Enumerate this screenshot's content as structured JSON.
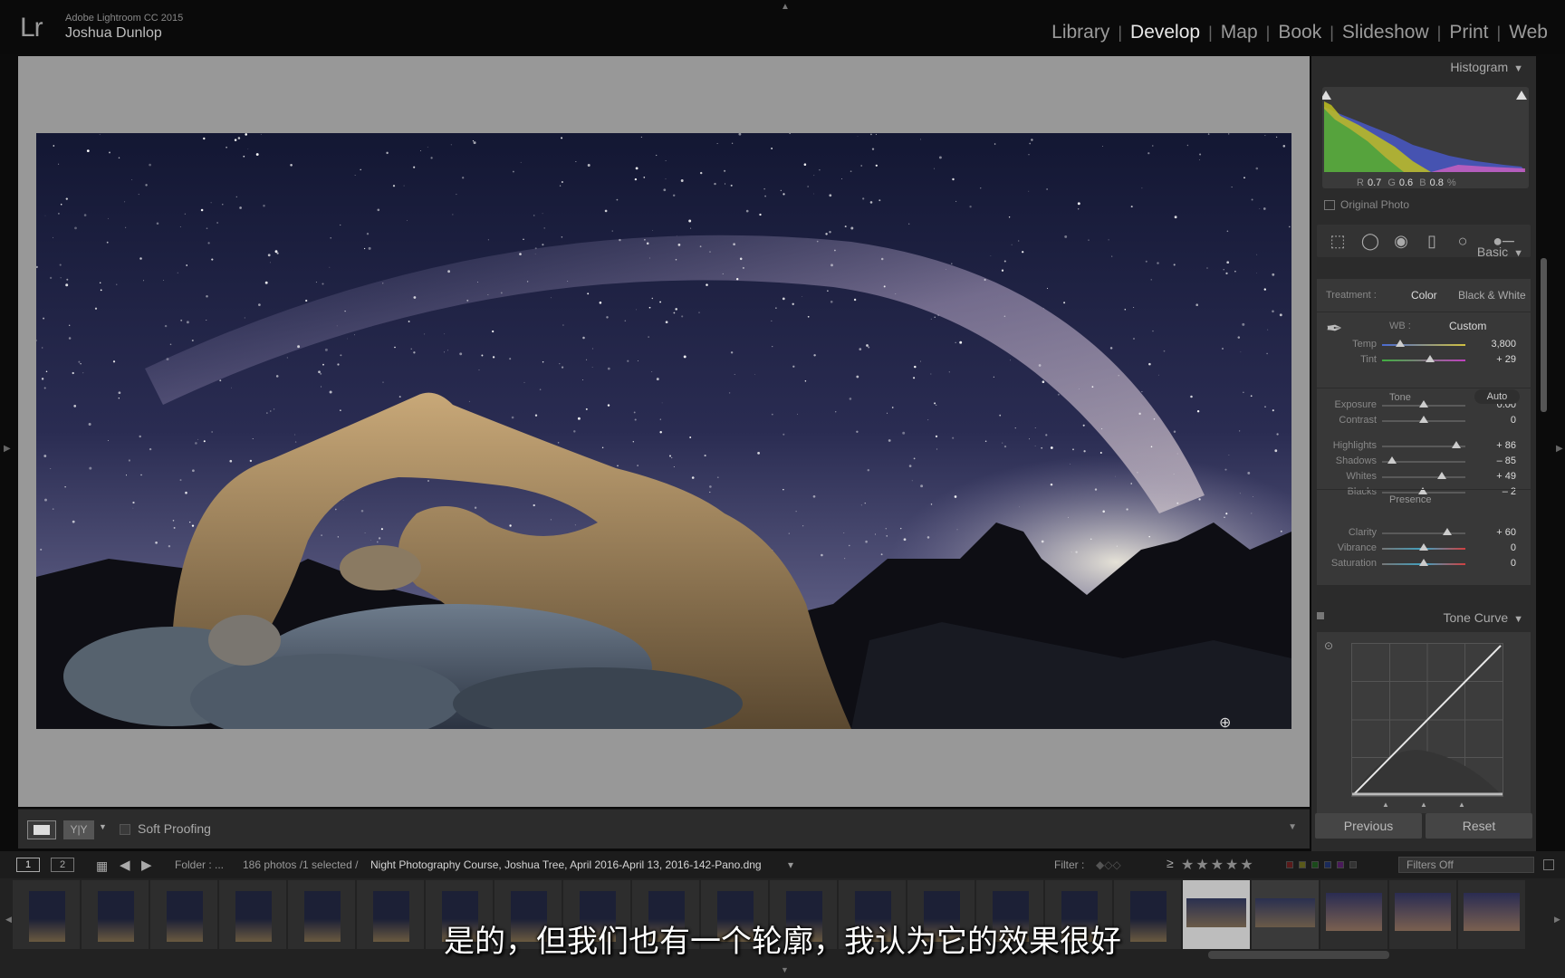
{
  "app": {
    "version": "Adobe Lightroom CC 2015",
    "user": "Joshua Dunlop",
    "logo": "Lr"
  },
  "modules": [
    {
      "label": "Library",
      "active": false
    },
    {
      "label": "Develop",
      "active": true
    },
    {
      "label": "Map",
      "active": false
    },
    {
      "label": "Book",
      "active": false
    },
    {
      "label": "Slideshow",
      "active": false
    },
    {
      "label": "Print",
      "active": false
    },
    {
      "label": "Web",
      "active": false
    }
  ],
  "toolbar": {
    "soft_proofing": "Soft Proofing",
    "compare_label": "Y|Y"
  },
  "histogram": {
    "title": "Histogram",
    "r_label": "R",
    "r_value": "0.7",
    "g_label": "G",
    "g_value": "0.6",
    "b_label": "B",
    "b_value": "0.8",
    "percent": "%",
    "original_photo": "Original Photo"
  },
  "basic": {
    "title": "Basic",
    "treatment_label": "Treatment :",
    "color_label": "Color",
    "bw_label": "Black & White",
    "wb_label": "WB :",
    "wb_value": "Custom",
    "tone_label": "Tone",
    "auto_label": "Auto",
    "presence_label": "Presence",
    "sliders": [
      {
        "label": "Temp",
        "value": "3,800",
        "pos": 0.22,
        "gradient": "temp"
      },
      {
        "label": "Tint",
        "value": "+ 29",
        "pos": 0.58,
        "gradient": "tint"
      },
      {
        "label": "Exposure",
        "value": "0.00",
        "pos": 0.5,
        "gradient": "none"
      },
      {
        "label": "Contrast",
        "value": "0",
        "pos": 0.5,
        "gradient": "none"
      },
      {
        "label": "Highlights",
        "value": "+ 86",
        "pos": 0.89,
        "gradient": "none"
      },
      {
        "label": "Shadows",
        "value": "– 85",
        "pos": 0.12,
        "gradient": "none"
      },
      {
        "label": "Whites",
        "value": "+ 49",
        "pos": 0.72,
        "gradient": "none"
      },
      {
        "label": "Blacks",
        "value": "– 2",
        "pos": 0.49,
        "gradient": "none"
      },
      {
        "label": "Clarity",
        "value": "+ 60",
        "pos": 0.78,
        "gradient": "none"
      },
      {
        "label": "Vibrance",
        "value": "0",
        "pos": 0.5,
        "gradient": "sat"
      },
      {
        "label": "Saturation",
        "value": "0",
        "pos": 0.5,
        "gradient": "sat"
      }
    ]
  },
  "tone_curve": {
    "title": "Tone Curve"
  },
  "buttons": {
    "previous": "Previous",
    "reset": "Reset"
  },
  "filmbar": {
    "screen1": "1",
    "screen2": "2",
    "folder_label": "Folder : ...",
    "count": "186 photos /1 selected /",
    "path": "Night Photography Course, Joshua Tree, April 2016-April 13, 2016-142-Pano.dng",
    "filter_label": "Filter :",
    "rating_op": "≥",
    "stars": "★★★★★",
    "filters_off": "Filters Off"
  },
  "subtitle": "是的，但我们也有一个轮廓，我认为它的效果很好",
  "colors": {
    "accent": "#e8e8e8",
    "panel": "#2b2b2b",
    "view": "#989898"
  }
}
